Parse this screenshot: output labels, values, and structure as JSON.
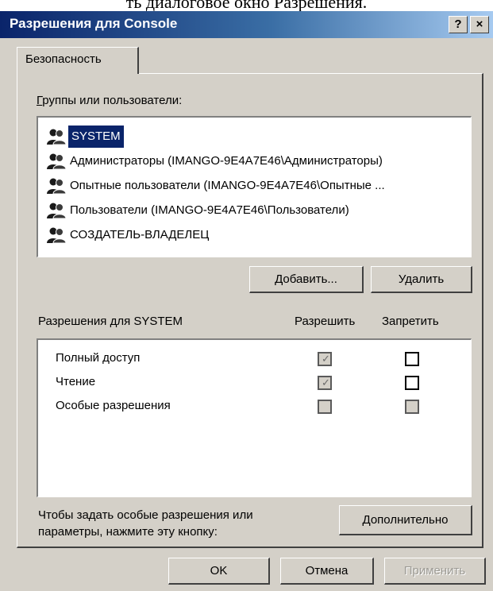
{
  "document": {
    "visible_text": "ть диалоговое окно Разрешения."
  },
  "window": {
    "title": "Разрешения для Console",
    "help_button": "?",
    "close_button": "×"
  },
  "tabs": [
    {
      "label": "Безопасность",
      "active": true
    }
  ],
  "groups": {
    "label": "Группы или пользователи:",
    "items": [
      {
        "name": "SYSTEM",
        "selected": true,
        "icon": "users-group-icon"
      },
      {
        "name": "Администраторы (IMANGO-9E4A7E46\\Администраторы)",
        "selected": false,
        "icon": "users-group-icon"
      },
      {
        "name": "Опытные пользователи (IMANGO-9E4A7E46\\Опытные ...",
        "selected": false,
        "icon": "users-group-icon"
      },
      {
        "name": "Пользователи (IMANGO-9E4A7E46\\Пользователи)",
        "selected": false,
        "icon": "users-group-icon"
      },
      {
        "name": "СОЗДАТЕЛЬ-ВЛАДЕЛЕЦ",
        "selected": false,
        "icon": "users-group-icon"
      }
    ]
  },
  "buttons": {
    "add": "Добавить...",
    "remove": "Удалить",
    "advanced": "Дополнительно",
    "ok": "OK",
    "cancel": "Отмена",
    "apply": "Применить"
  },
  "permissions": {
    "label": "Разрешения для SYSTEM",
    "allow_header": "Разрешить",
    "deny_header": "Запретить",
    "rows": [
      {
        "name": "Полный доступ",
        "allow": "checked-disabled",
        "deny": "unchecked"
      },
      {
        "name": "Чтение",
        "allow": "checked-disabled",
        "deny": "unchecked"
      },
      {
        "name": "Особые разрешения",
        "allow": "unchecked-disabled",
        "deny": "unchecked-disabled"
      }
    ]
  },
  "hint": {
    "line1": "Чтобы задать особые разрешения или",
    "line2": "параметры, нажмите эту кнопку:"
  },
  "colors": {
    "title_bar_start": "#0a246a",
    "title_bar_end": "#a6caf0",
    "selection": "#0a246a",
    "face": "#d4d0c8"
  }
}
